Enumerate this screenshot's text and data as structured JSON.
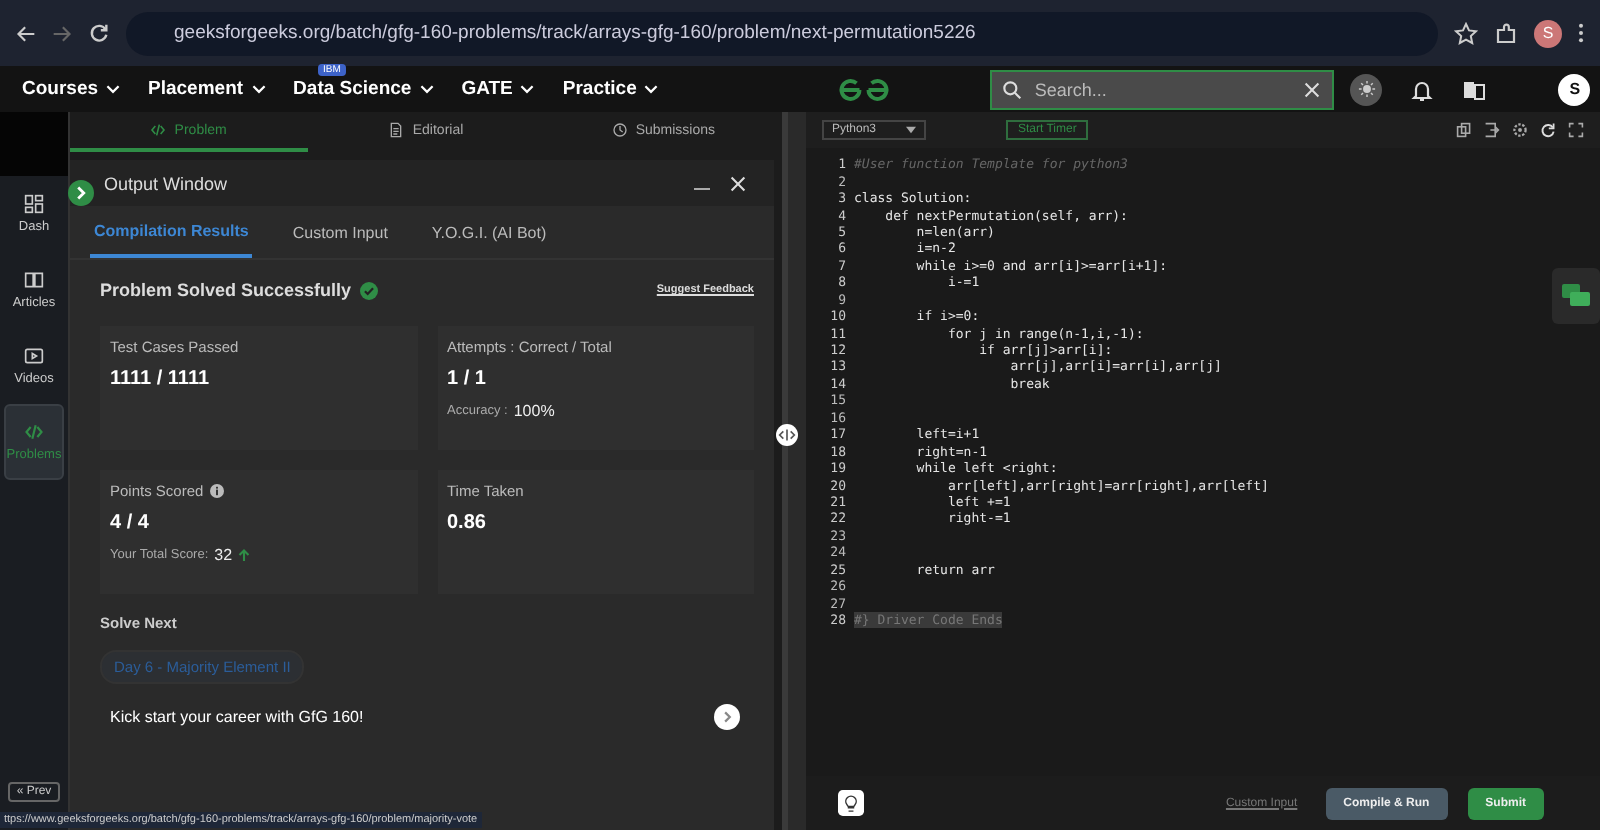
{
  "browser": {
    "url": "geeksforgeeks.org/batch/gfg-160-problems/track/arrays-gfg-160/problem/next-permutation5226",
    "profile_initial": "S"
  },
  "nav": {
    "items": [
      {
        "label": "Courses"
      },
      {
        "label": "Placement"
      },
      {
        "label": "Data Science",
        "badge": "IBM"
      },
      {
        "label": "GATE"
      },
      {
        "label": "Practice"
      }
    ],
    "search": {
      "placeholder": "Search..."
    },
    "avatar": "S"
  },
  "sidebar": {
    "items": [
      {
        "label": "Dash",
        "selected": false
      },
      {
        "label": "Articles",
        "selected": false
      },
      {
        "label": "Videos",
        "selected": false
      },
      {
        "label": "Problems",
        "selected": true
      }
    ],
    "prev": "« Prev"
  },
  "problem_tabs": [
    {
      "label": "Problem",
      "selected": true
    },
    {
      "label": "Editorial",
      "selected": false
    },
    {
      "label": "Submissions",
      "selected": false
    }
  ],
  "output_window": {
    "title": "Output Window",
    "tabs": [
      {
        "label": "Compilation Results",
        "selected": true
      },
      {
        "label": "Custom Input",
        "selected": false
      },
      {
        "label": "Y.O.G.I. (AI Bot)",
        "selected": false
      }
    ],
    "status": "Problem Solved Successfully",
    "feedback": "Suggest Feedback",
    "cards": [
      {
        "label": "Test Cases Passed",
        "value": "1111 / 1111",
        "info": false
      },
      {
        "label": "Attempts : Correct / Total",
        "value": "1 / 1",
        "note_label": "Accuracy :",
        "note_value": "100%",
        "info": false
      },
      {
        "label": "Points Scored",
        "value": "4 / 4",
        "note_label": "Your Total Score:",
        "note_value": "32",
        "rising": true,
        "info": true
      },
      {
        "label": "Time Taken",
        "value": "0.86",
        "info": false
      }
    ],
    "solve_next": {
      "heading": "Solve Next",
      "chip": "Day 6 - Majority Element II",
      "promo": "Kick start your career with GfG 160!"
    }
  },
  "status_url": "ttps://www.geeksforgeeks.org/batch/gfg-160-problems/track/arrays-gfg-160/problem/majority-vote",
  "editor": {
    "language": "Python3",
    "timer": "Start Timer",
    "lines": [
      {
        "number": "1",
        "text": "#User function Template for python3",
        "kind": "comment"
      },
      {
        "number": "2",
        "kind": "blank"
      },
      {
        "number": "3",
        "text": "class Solution:",
        "kind": "code"
      },
      {
        "number": "4",
        "text": "    def nextPermutation(self, arr):",
        "kind": "code"
      },
      {
        "number": "5",
        "text": "        n=len(arr)",
        "kind": "code"
      },
      {
        "number": "6",
        "text": "        i=n-2",
        "kind": "code"
      },
      {
        "number": "7",
        "text": "        while i>=0 and arr[i]>=arr[i+1]:",
        "kind": "code"
      },
      {
        "number": "8",
        "text": "            i-=1",
        "kind": "code"
      },
      {
        "number": "9",
        "kind": "blank"
      },
      {
        "number": "10",
        "text": "        if i>=0:",
        "kind": "code"
      },
      {
        "number": "11",
        "text": "            for j in range(n-1,i,-1):",
        "kind": "code"
      },
      {
        "number": "12",
        "text": "                if arr[j]>arr[i]:",
        "kind": "code"
      },
      {
        "number": "13",
        "text": "                    arr[j],arr[i]=arr[i],arr[j]",
        "kind": "code"
      },
      {
        "number": "14",
        "text": "                    break",
        "kind": "code"
      },
      {
        "number": "15",
        "kind": "blank"
      },
      {
        "number": "16",
        "kind": "blank"
      },
      {
        "number": "17",
        "text": "        left=i+1",
        "kind": "code"
      },
      {
        "number": "18",
        "text": "        right=n-1",
        "kind": "code"
      },
      {
        "number": "19",
        "text": "        while left <right:",
        "kind": "code"
      },
      {
        "number": "20",
        "text": "            arr[left],arr[right]=arr[right],arr[left]",
        "kind": "code"
      },
      {
        "number": "21",
        "text": "            left +=1",
        "kind": "code"
      },
      {
        "number": "22",
        "text": "            right-=1",
        "kind": "code"
      },
      {
        "number": "23",
        "kind": "blank"
      },
      {
        "number": "24",
        "kind": "blank"
      },
      {
        "number": "25",
        "text": "        return arr",
        "kind": "code"
      },
      {
        "number": "26",
        "kind": "blank"
      },
      {
        "number": "27",
        "kind": "blank"
      },
      {
        "number": "28",
        "text": "#} Driver Code Ends",
        "kind": "selected"
      }
    ],
    "custom_input": "Custom Input",
    "compile": "Compile & Run",
    "submit": "Submit"
  }
}
